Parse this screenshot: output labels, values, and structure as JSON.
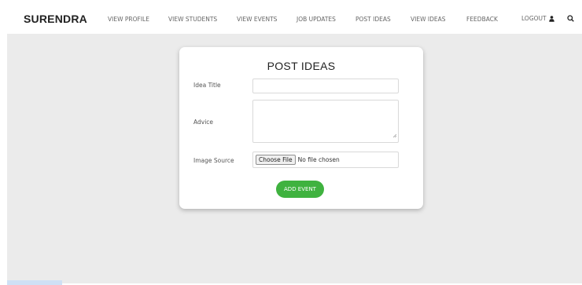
{
  "navbar": {
    "brand": "SURENDRA",
    "items": [
      {
        "label": "VIEW PROFILE"
      },
      {
        "label": "VIEW STUDENTS"
      },
      {
        "label": "VIEW EVENTS"
      },
      {
        "label": "JOB UPDATES"
      },
      {
        "label": "POST IDEAS"
      },
      {
        "label": "VIEW IDEAS"
      },
      {
        "label": "FEEDBACK"
      }
    ],
    "logout_label": "LOGOUT",
    "icons": {
      "logout": "user-icon",
      "search": "search-icon"
    }
  },
  "form": {
    "title": "POST IDEAS",
    "idea_title_label": "Idea Title",
    "idea_title_value": "",
    "advice_label": "Advice",
    "advice_value": "",
    "image_source_label": "Image Source",
    "choose_file_label": "Choose File",
    "file_status": "No file chosen",
    "submit_label": "ADD EVENT"
  },
  "colors": {
    "accent": "#3fb23f",
    "background": "#ebebeb",
    "card": "#ffffff"
  }
}
